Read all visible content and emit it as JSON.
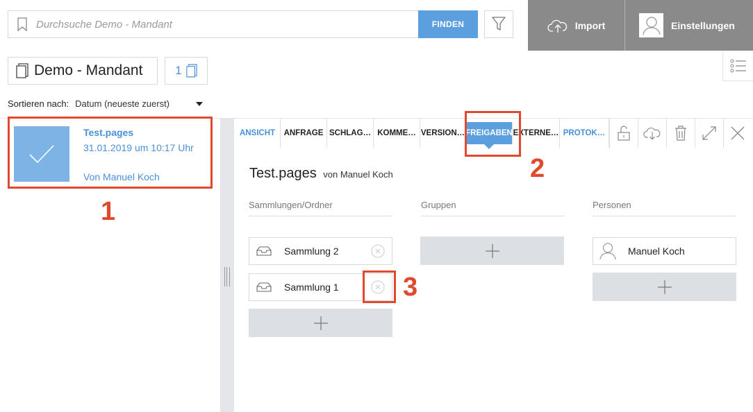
{
  "search": {
    "placeholder": "Durchsuche Demo - Mandant",
    "find_label": "FINDEN"
  },
  "header": {
    "import_label": "Import",
    "settings_label": "Einstellungen"
  },
  "mandant": {
    "name": "Demo - Mandant",
    "count": "1"
  },
  "sort": {
    "label": "Sortieren nach:",
    "value": "Datum (neueste zuerst)"
  },
  "document": {
    "name": "Test.pages",
    "date": "31.01.2019 um 10:17 Uhr",
    "author": "Von Manuel Koch"
  },
  "tabs": [
    {
      "label": "ANSICHT"
    },
    {
      "label": "ANFRAGE"
    },
    {
      "label": "SCHLAG…"
    },
    {
      "label": "KOMME…"
    },
    {
      "label": "VERSION…"
    },
    {
      "label": "FREIGABEN"
    },
    {
      "label": "EXTERNE…"
    },
    {
      "label": "PROTOK…"
    }
  ],
  "detail": {
    "title": "Test.pages",
    "by": "von Manuel Koch",
    "col_collections": "Sammlungen/Ordner",
    "col_groups": "Gruppen",
    "col_persons": "Personen",
    "collections": [
      {
        "label": "Sammlung 2"
      },
      {
        "label": "Sammlung 1"
      }
    ],
    "persons": [
      {
        "label": "Manuel Koch"
      }
    ]
  },
  "annotations": {
    "n1": "1",
    "n2": "2",
    "n3": "3"
  },
  "colors": {
    "accent": "#5b9fde",
    "link": "#4a90d9",
    "highlight": "#e0492b",
    "header_bg": "#8a8a8a"
  }
}
